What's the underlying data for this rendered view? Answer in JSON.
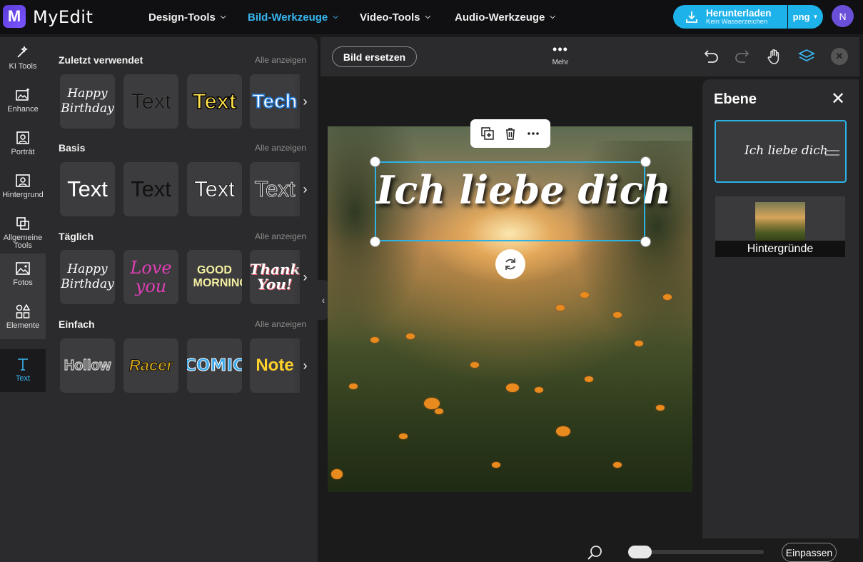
{
  "app": {
    "brand": "MyEdit",
    "logo_letter": "M",
    "accent": "#1eb2ea",
    "highlight": "#38b6f0"
  },
  "nav": {
    "items": [
      {
        "label": "Design-Tools",
        "active": false
      },
      {
        "label": "Bild-Werkzeuge",
        "active": true
      },
      {
        "label": "Video-Tools",
        "active": false
      },
      {
        "label": "Audio-Werkzeuge",
        "active": false
      }
    ]
  },
  "download": {
    "title": "Herunterladen",
    "subtitle": "Kein Wasserzeichen",
    "format": "png"
  },
  "user": {
    "initial": "N"
  },
  "rail": {
    "items": [
      {
        "label": "KI Tools",
        "icon": "magic-wand-icon"
      },
      {
        "label": "Enhance",
        "icon": "image-sparkle-icon"
      },
      {
        "label": "Porträt",
        "icon": "portrait-icon"
      },
      {
        "label": "Hintergrund",
        "icon": "background-icon"
      },
      {
        "label": "Allgemeine Tools",
        "icon": "crop-tools-icon"
      },
      {
        "label": "Fotos",
        "icon": "photo-icon"
      },
      {
        "label": "Elemente",
        "icon": "shapes-icon"
      },
      {
        "label": "Text",
        "icon": "text-t-icon"
      }
    ],
    "plus": "+"
  },
  "panel": {
    "sections": [
      {
        "title": "Zuletzt verwendet",
        "link": "Alle anzeigen",
        "tiles": [
          "Happy Birthday",
          "Text",
          "Text",
          "Tech"
        ]
      },
      {
        "title": "Basis",
        "link": "Alle anzeigen",
        "tiles": [
          "Text",
          "Text",
          "Text",
          "Text"
        ]
      },
      {
        "title": "Täglich",
        "link": "Alle anzeigen",
        "tiles": [
          "Happy Birthday",
          "Love you",
          "GOOD MORNING",
          "Thank You!"
        ]
      },
      {
        "title": "Einfach",
        "link": "Alle anzeigen",
        "tiles": [
          "Hollow",
          "Racer",
          "COMIC",
          "Note"
        ]
      }
    ]
  },
  "toolbar": {
    "replace": "Bild ersetzen",
    "more": "Mehr",
    "more_dots": "•••"
  },
  "canvas": {
    "text": "Ich liebe dich"
  },
  "layers": {
    "title": "Ebene",
    "close": "✕",
    "text_layer": "Ich liebe dich",
    "background_label": "Hintergründe"
  },
  "zoom": {
    "fit": "Einpassen",
    "level": 0.0
  }
}
